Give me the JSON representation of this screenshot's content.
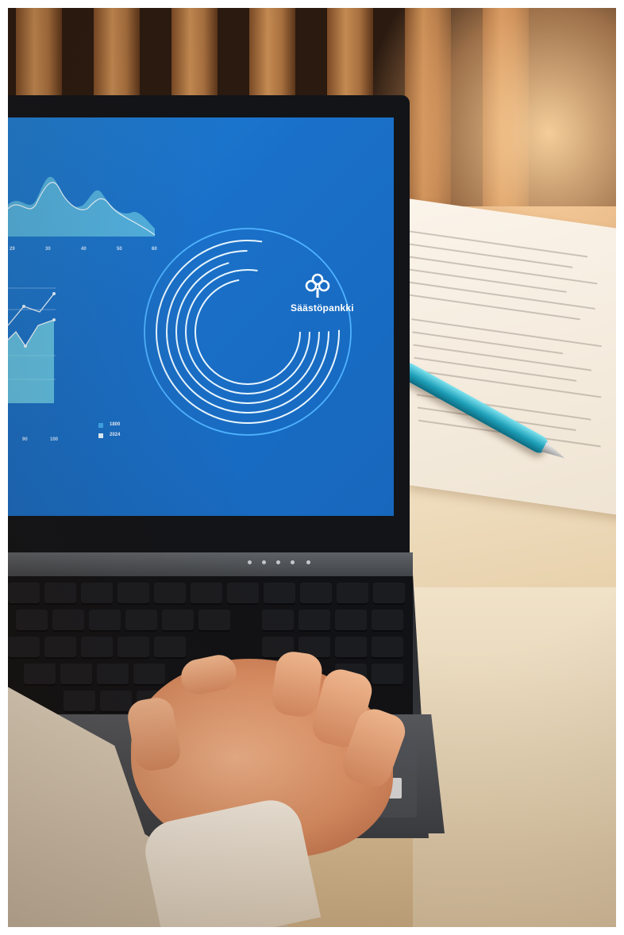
{
  "photo": {
    "screen": {
      "brand_name": "Säästöpankki",
      "brand_icon": "clover-tree-icon",
      "top_axis_ticks": [
        "29",
        "30",
        "40",
        "50",
        "60"
      ],
      "bottom_axis_ticks": [
        "90",
        "100"
      ],
      "legend": [
        {
          "label": "1800",
          "color": "#3fa9f0"
        },
        {
          "label": "2024",
          "color": "#e8f6ff"
        }
      ]
    },
    "colors": {
      "screen_blue": "#1a70c8",
      "chart_cyan": "#7fe3f0",
      "pen_teal": "#1e9fb8"
    }
  }
}
